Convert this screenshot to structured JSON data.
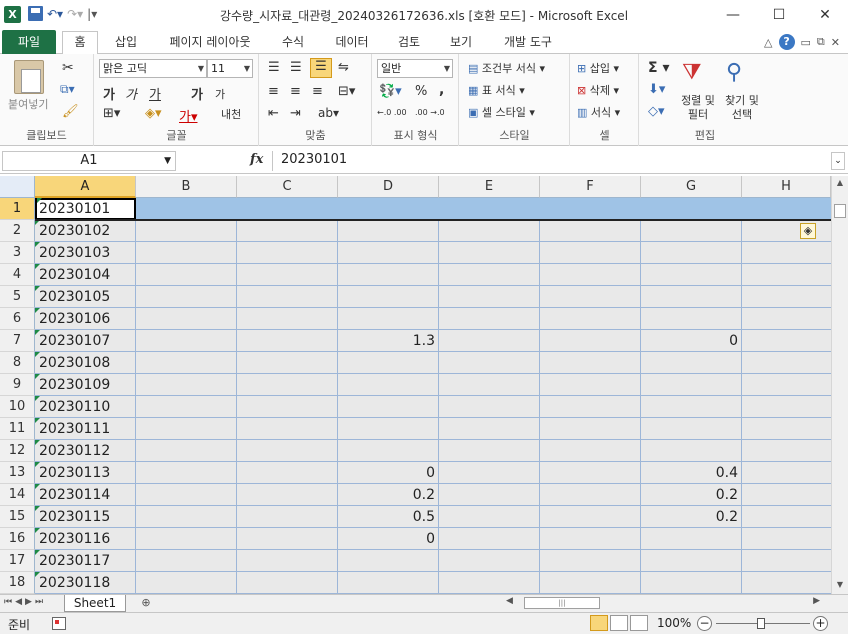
{
  "app": {
    "title": "강수량_시자료_대관령_20240326172636.xls  [호환 모드]  -  Microsoft Excel",
    "logo_text": "X"
  },
  "window_controls": {
    "minimize": "—",
    "maximize": "☐",
    "close": "✕"
  },
  "ribbon_tabs": {
    "file": "파일",
    "home": "홈",
    "insert": "삽입",
    "page_layout": "페이지 레이아웃",
    "formulas": "수식",
    "data": "데이터",
    "review": "검토",
    "view": "보기",
    "developer": "개발 도구"
  },
  "ribbon": {
    "clipboard": {
      "paste": "붙여넣기",
      "label": "클립보드"
    },
    "font": {
      "name": "맑은 고딕",
      "size": "11",
      "label": "글꼴",
      "bold": "가",
      "italic": "가",
      "underline": "가",
      "grow": "가",
      "shrink": "가",
      "phonetic": "내천"
    },
    "alignment": {
      "label": "맞춤"
    },
    "number": {
      "format": "일반",
      "label": "표시 형식",
      "percent": "%",
      "comma": ",",
      "inc": "←.0 .00",
      "dec": ".00 →.0"
    },
    "styles": {
      "conditional": "조건부 서식",
      "table": "표 서식",
      "cell": "셀 스타일",
      "label": "스타일"
    },
    "cells": {
      "insert": "삽입",
      "delete": "삭제",
      "format": "서식",
      "label": "셀"
    },
    "editing": {
      "sum": "Σ",
      "sort": "정렬 및 필터",
      "find": "찾기 및 선택",
      "label": "편집"
    }
  },
  "formula_bar": {
    "name_box": "A1",
    "fx": "fx",
    "value": "20230101"
  },
  "columns": [
    "A",
    "B",
    "C",
    "D",
    "E",
    "F",
    "G",
    "H"
  ],
  "rows": [
    {
      "n": "1",
      "a": "20230101",
      "d": "",
      "g": ""
    },
    {
      "n": "2",
      "a": "20230102",
      "d": "",
      "g": ""
    },
    {
      "n": "3",
      "a": "20230103",
      "d": "",
      "g": ""
    },
    {
      "n": "4",
      "a": "20230104",
      "d": "",
      "g": ""
    },
    {
      "n": "5",
      "a": "20230105",
      "d": "",
      "g": ""
    },
    {
      "n": "6",
      "a": "20230106",
      "d": "",
      "g": ""
    },
    {
      "n": "7",
      "a": "20230107",
      "d": "1.3",
      "g": "0"
    },
    {
      "n": "8",
      "a": "20230108",
      "d": "",
      "g": ""
    },
    {
      "n": "9",
      "a": "20230109",
      "d": "",
      "g": ""
    },
    {
      "n": "10",
      "a": "20230110",
      "d": "",
      "g": ""
    },
    {
      "n": "11",
      "a": "20230111",
      "d": "",
      "g": ""
    },
    {
      "n": "12",
      "a": "20230112",
      "d": "",
      "g": ""
    },
    {
      "n": "13",
      "a": "20230113",
      "d": "0",
      "g": "0.4"
    },
    {
      "n": "14",
      "a": "20230114",
      "d": "0.2",
      "g": "0.2"
    },
    {
      "n": "15",
      "a": "20230115",
      "d": "0.5",
      "g": "0.2"
    },
    {
      "n": "16",
      "a": "20230116",
      "d": "0",
      "g": ""
    },
    {
      "n": "17",
      "a": "20230117",
      "d": "",
      "g": ""
    },
    {
      "n": "18",
      "a": "20230118",
      "d": "",
      "g": ""
    }
  ],
  "sheet_tabs": {
    "active": "Sheet1"
  },
  "status_bar": {
    "ready": "준비",
    "zoom": "100%",
    "zoom_minus": "−",
    "zoom_plus": "+"
  },
  "colors": {
    "excel_green": "#1e7145",
    "selection_highlight": "#9fc3e6",
    "header_selected": "#f8d67a"
  }
}
